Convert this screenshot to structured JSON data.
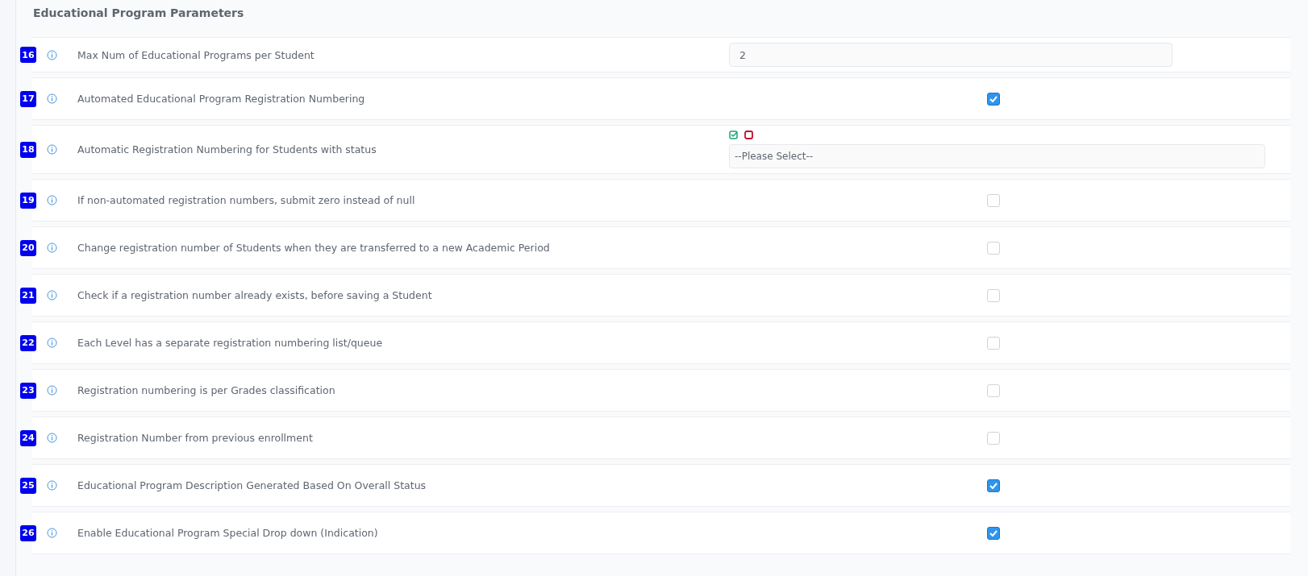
{
  "section_title": "Educational Program Parameters",
  "rows": [
    {
      "number": "16",
      "label": "Max Num of Educational Programs per Student",
      "kind": "number",
      "value": "2"
    },
    {
      "number": "17",
      "label": "Automated Educational Program Registration Numbering",
      "kind": "checkbox",
      "checked": true
    },
    {
      "number": "18",
      "label": "Automatic Registration Numbering for Students with status",
      "kind": "multiselect",
      "placeholder": "--Please Select--"
    },
    {
      "number": "19",
      "label": "If non-automated registration numbers, submit zero instead of null",
      "kind": "checkbox",
      "checked": false
    },
    {
      "number": "20",
      "label": "Change registration number of Students when they are transferred to a new Academic Period",
      "kind": "checkbox",
      "checked": false
    },
    {
      "number": "21",
      "label": "Check if a registration number already exists, before saving a Student",
      "kind": "checkbox",
      "checked": false
    },
    {
      "number": "22",
      "label": "Each Level has a separate registration numbering list/queue",
      "kind": "checkbox",
      "checked": false
    },
    {
      "number": "23",
      "label": "Registration numbering is per Grades classification",
      "kind": "checkbox",
      "checked": false
    },
    {
      "number": "24",
      "label": "Registration Number from previous enrollment",
      "kind": "checkbox",
      "checked": false
    },
    {
      "number": "25",
      "label": "Educational Program Description Generated Based On Overall Status",
      "kind": "checkbox",
      "checked": true
    },
    {
      "number": "26",
      "label": "Enable Educational Program Special Drop down (Indication)",
      "kind": "checkbox",
      "checked": true
    }
  ]
}
